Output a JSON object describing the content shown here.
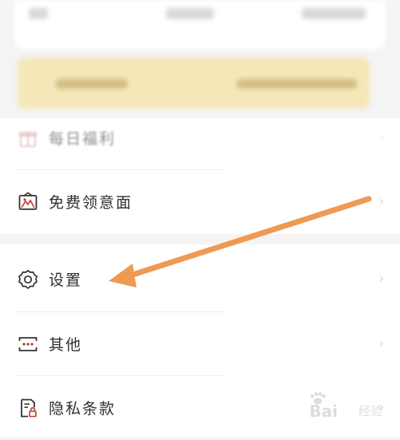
{
  "menu": {
    "items": [
      {
        "label": "每日福利",
        "icon": "gift-icon"
      },
      {
        "label": "免费领意面",
        "icon": "picture-frame-icon"
      },
      {
        "label": "设置",
        "icon": "gear-icon"
      },
      {
        "label": "其他",
        "icon": "ellipsis-box-icon"
      },
      {
        "label": "隐私条款",
        "icon": "document-lock-icon"
      }
    ]
  },
  "colors": {
    "arrow": "#ef9a52",
    "banner": "#f6e7b8",
    "background": "#f4f4f4"
  },
  "watermark": {
    "brand": "Bai",
    "text": "经验"
  }
}
